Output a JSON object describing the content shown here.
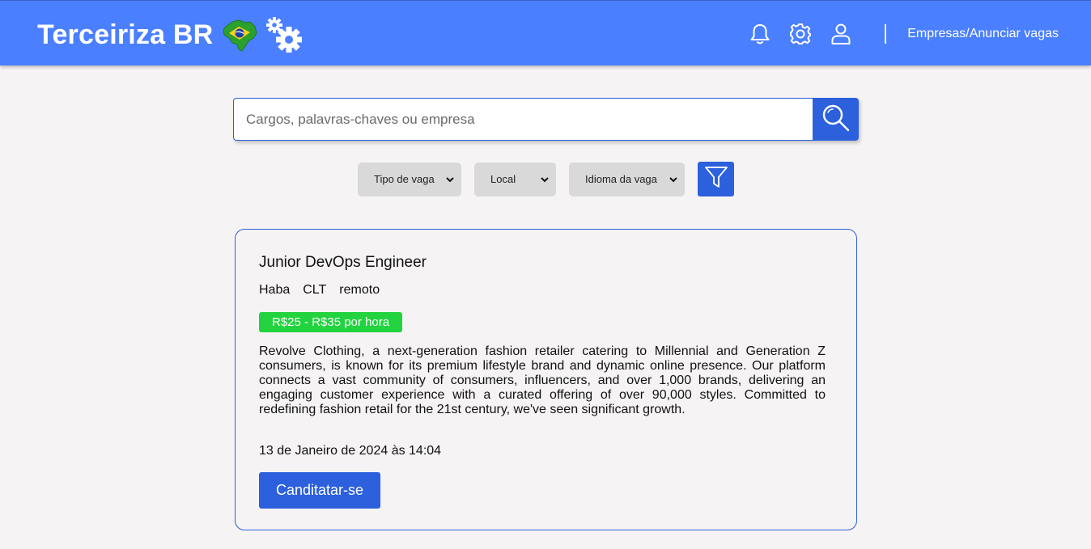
{
  "header": {
    "brand_title": "Terceiriza BR",
    "company_link": "Empresas/Anunciar vagas",
    "icons": [
      "brazil-map-icon",
      "gears-icon",
      "bell-icon",
      "gear-icon",
      "user-icon"
    ],
    "background_color": "#4a7fff"
  },
  "search": {
    "placeholder": "Cargos, palavras-chaves ou empresa",
    "value": "",
    "button_icon": "search-icon",
    "accent_color": "#2c60dc"
  },
  "filters": {
    "job_type": "Tipo de vaga",
    "location": "Local",
    "language": "Idioma da vaga",
    "filter_icon": "filter-icon"
  },
  "job": {
    "title": "Junior DevOps Engineer",
    "company": "Haba",
    "contract": "CLT",
    "mode": "remoto",
    "salary": "R$25 - R$35 por hora",
    "salary_color": "#22d33f",
    "description": "Revolve Clothing, a next-generation fashion retailer catering to Millennial and Generation Z consumers, is known for its premium lifestyle brand and dynamic online presence. Our platform connects a vast community of consumers, influencers, and over 1,000 brands, delivering an engaging customer experience with a curated offering of over 90,000 styles. Committed to redefining fashion retail for the 21st century, we've seen significant growth.",
    "posted": "13 de Janeiro de 2024 às 14:04",
    "apply_label": "Canditatar-se"
  }
}
